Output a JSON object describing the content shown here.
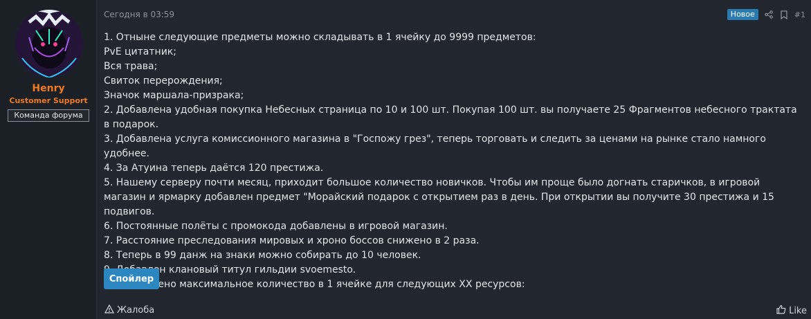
{
  "user": {
    "name": "Henry",
    "title": "Customer Support",
    "banner": "Команда форума",
    "name_color": "#f07b1f"
  },
  "post": {
    "date": "Сегодня в 03:59",
    "new_badge": "Новое",
    "number": "#1",
    "lines": [
      "1. Отныне следующие предметы можно складывать в 1 ячейку до 9999 предметов:",
      "PvE цитатник;",
      "Вся трава;",
      "Свиток перерождения;",
      "Значок маршала-призрака;",
      "2. Добавлена удобная покупка Небесных страница по 10 и 100 шт. Покупая 100 шт. вы получаете 25 Фрагментов небесного трактата в подарок.",
      "3. Добавлена услуга комиссионного магазина в \"Госпожу грез\", теперь торговать и следить за ценами на рынке стало намного удобнее.",
      "4. За Атуина теперь даётся 120 престижа.",
      "5. Нашему серверу почти месяц, приходит большое количество новичков. Чтобы им проще было догнать старичков, в игровой магазин и ярмарку добавлен предмет \"Морайский подарок с открытием раз в день. При открытии вы получите 30 престижа и 15 подвигов.",
      "6. Постоянные полёты с промокода добавлены в игровой магазин.",
      "7. Расстояние преследования мировых и хроно боссов снижено в 2 раза.",
      "8. Теперь в 99 данж на знаки можно собирать до 10 человек.",
      "9. Добавлен клановый титул гильдии svoemesto.",
      "10. Увеличено максимальное количество в 1 ячейке для следующих ХХ ресурсов:"
    ],
    "spoiler_label": "Спойлер"
  },
  "actions": {
    "report_label": "Жалоба",
    "like_label": "Like"
  },
  "icons": {
    "share": "share-icon",
    "bookmark": "bookmark-icon",
    "report": "warning-icon",
    "like": "thumbs-up-icon"
  },
  "colors": {
    "background": "#22262e",
    "accent": "#2c86c0",
    "badge": "#2a7ab0"
  }
}
